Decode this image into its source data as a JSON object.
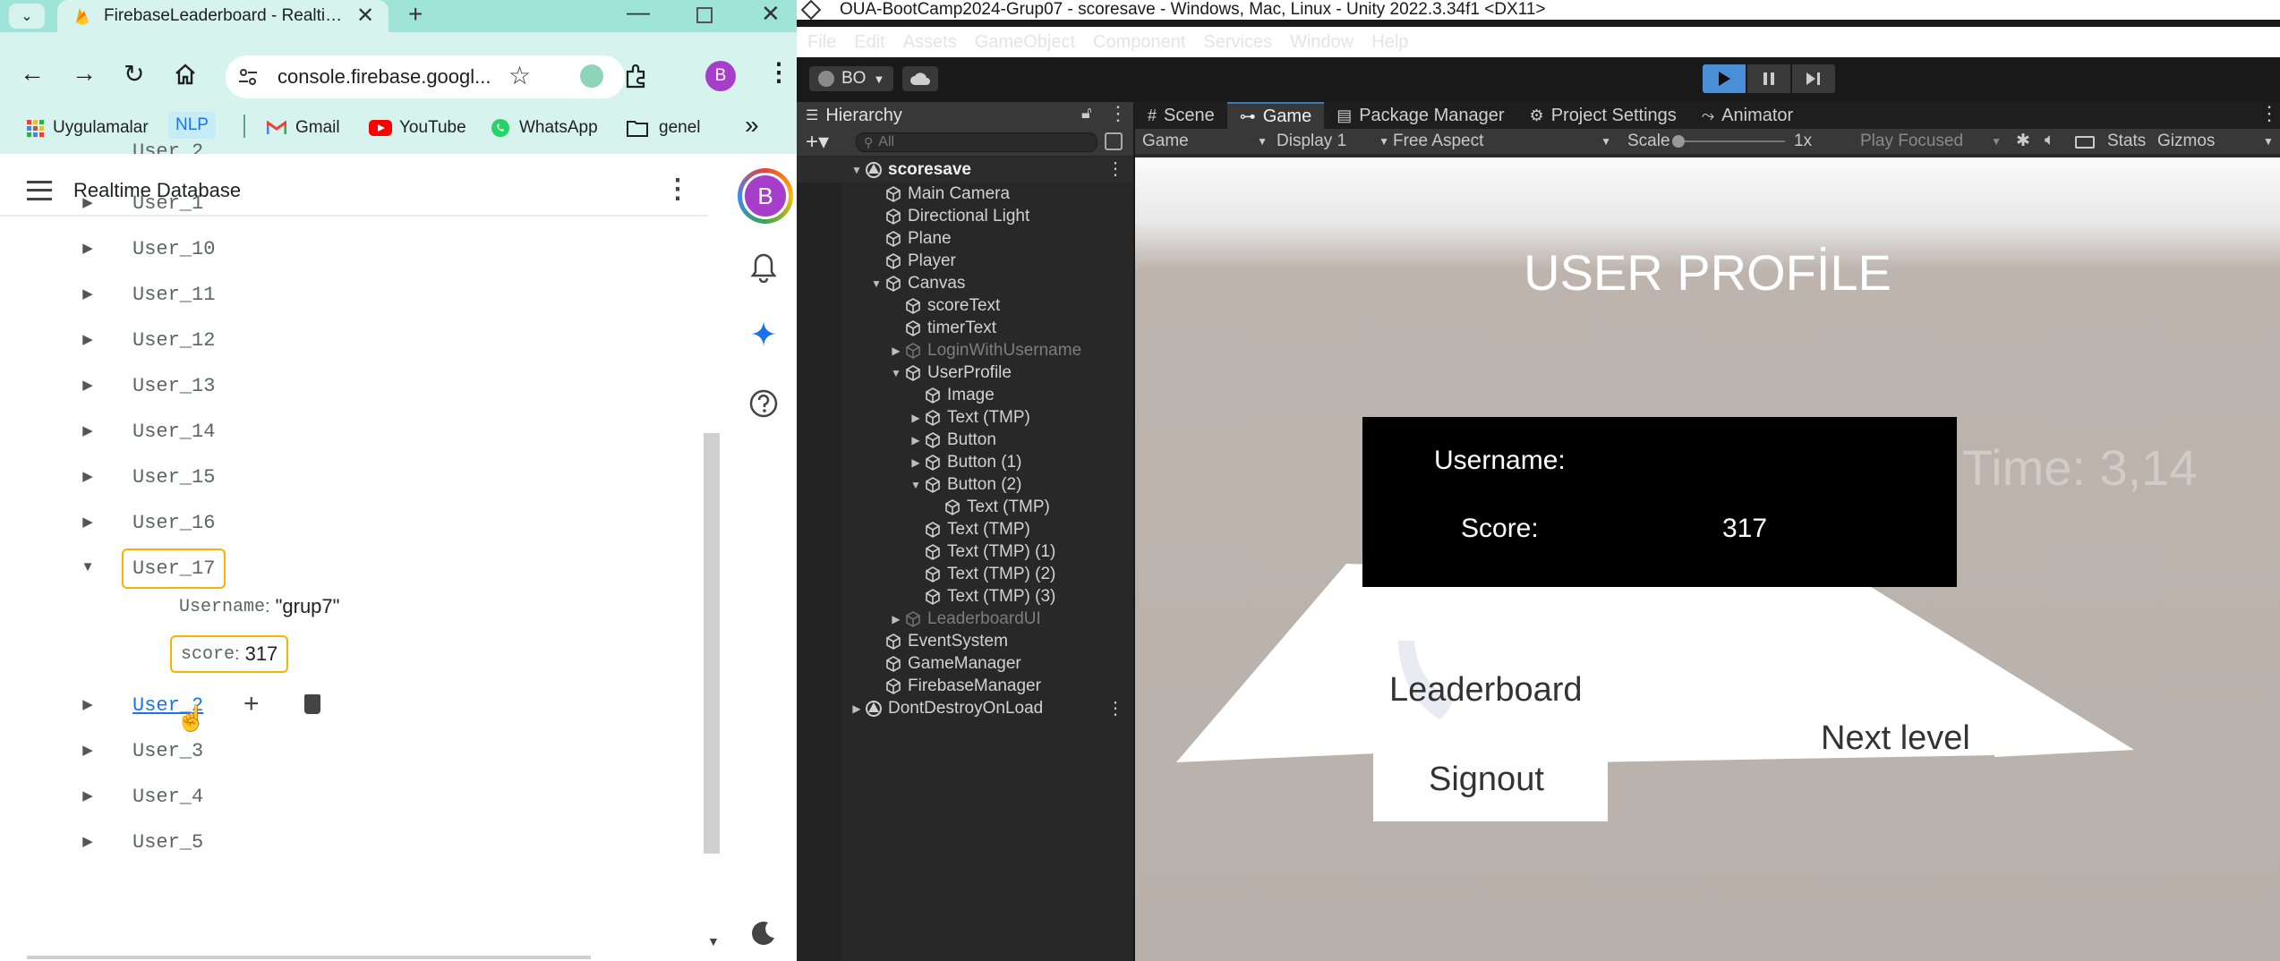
{
  "browser": {
    "tab_title": "FirebaseLeaderboard - Realtime Database",
    "new_tab": "+",
    "url": "console.firebase.googl...",
    "profile_letter": "B",
    "bookmarks": [
      {
        "label": "Uygulamalar",
        "icon": "apps-grid-icon"
      },
      {
        "label": "NLP",
        "icon": ""
      },
      {
        "label": "Gmail",
        "icon": "gmail-icon"
      },
      {
        "label": "YouTube",
        "icon": "youtube-icon"
      },
      {
        "label": "WhatsApp",
        "icon": "whatsapp-icon"
      },
      {
        "label": "genel",
        "icon": "folder-icon"
      }
    ],
    "more_bookmarks": "»"
  },
  "firebase": {
    "header_title": "Realtime Database",
    "avatar_letter": "B",
    "nodes": [
      "User_1",
      "User_10",
      "User_11",
      "User_12",
      "User_13",
      "User_14",
      "User_15",
      "User_16",
      "User_17"
    ],
    "expanded_node": "User_17",
    "children": [
      {
        "key": "Username",
        "value": "\"grup7\""
      },
      {
        "key": "score",
        "value": "317"
      }
    ],
    "hover_node": "User_2",
    "nodes_after": [
      "User_3",
      "User_4",
      "User_5"
    ]
  },
  "unity": {
    "window_title": "OUA-BootCamp2024-Grup07 - scoresave - Windows, Mac, Linux - Unity 2022.3.34f1 <DX11>",
    "menu": [
      "File",
      "Edit",
      "Assets",
      "GameObject",
      "Component",
      "Services",
      "Window",
      "Help"
    ],
    "account": "BO",
    "hierarchy": {
      "tab": "Hierarchy",
      "search_placeholder": "All",
      "items": [
        {
          "label": "scoresave",
          "depth": 0,
          "fold": "open",
          "kind": "scene",
          "dim": false
        },
        {
          "label": "Main Camera",
          "depth": 1,
          "fold": "",
          "kind": "go",
          "dim": false
        },
        {
          "label": "Directional Light",
          "depth": 1,
          "fold": "",
          "kind": "go",
          "dim": false
        },
        {
          "label": "Plane",
          "depth": 1,
          "fold": "",
          "kind": "go",
          "dim": false
        },
        {
          "label": "Player",
          "depth": 1,
          "fold": "",
          "kind": "go",
          "dim": false
        },
        {
          "label": "Canvas",
          "depth": 1,
          "fold": "open",
          "kind": "go",
          "dim": false
        },
        {
          "label": "scoreText",
          "depth": 2,
          "fold": "",
          "kind": "go",
          "dim": false
        },
        {
          "label": "timerText",
          "depth": 2,
          "fold": "",
          "kind": "go",
          "dim": false
        },
        {
          "label": "LoginWithUsername",
          "depth": 2,
          "fold": "closed",
          "kind": "go",
          "dim": true
        },
        {
          "label": "UserProfile",
          "depth": 2,
          "fold": "open",
          "kind": "go",
          "dim": false
        },
        {
          "label": "Image",
          "depth": 3,
          "fold": "",
          "kind": "go",
          "dim": false
        },
        {
          "label": "Text (TMP)",
          "depth": 3,
          "fold": "closed",
          "kind": "go",
          "dim": false
        },
        {
          "label": "Button",
          "depth": 3,
          "fold": "closed",
          "kind": "go",
          "dim": false
        },
        {
          "label": "Button (1)",
          "depth": 3,
          "fold": "closed",
          "kind": "go",
          "dim": false
        },
        {
          "label": "Button (2)",
          "depth": 3,
          "fold": "open",
          "kind": "go",
          "dim": false
        },
        {
          "label": "Text (TMP)",
          "depth": 4,
          "fold": "",
          "kind": "go",
          "dim": false
        },
        {
          "label": "Text (TMP)",
          "depth": 3,
          "fold": "",
          "kind": "go",
          "dim": false
        },
        {
          "label": "Text (TMP) (1)",
          "depth": 3,
          "fold": "",
          "kind": "go",
          "dim": false
        },
        {
          "label": "Text (TMP) (2)",
          "depth": 3,
          "fold": "",
          "kind": "go",
          "dim": false
        },
        {
          "label": "Text (TMP) (3)",
          "depth": 3,
          "fold": "",
          "kind": "go",
          "dim": false
        },
        {
          "label": "LeaderboardUI",
          "depth": 2,
          "fold": "closed",
          "kind": "go",
          "dim": true
        },
        {
          "label": "EventSystem",
          "depth": 1,
          "fold": "",
          "kind": "go",
          "dim": false
        },
        {
          "label": "GameManager",
          "depth": 1,
          "fold": "",
          "kind": "go",
          "dim": false
        },
        {
          "label": "FirebaseManager",
          "depth": 1,
          "fold": "",
          "kind": "go",
          "dim": false
        },
        {
          "label": "DontDestroyOnLoad",
          "depth": 0,
          "fold": "closed",
          "kind": "scene",
          "dim": false
        }
      ]
    },
    "tabs": [
      "Scene",
      "Game",
      "Package Manager",
      "Project Settings",
      "Animator"
    ],
    "active_tab": "Game",
    "game_toolbar": {
      "mode": "Game",
      "display": "Display 1",
      "aspect": "Free Aspect",
      "scale_label": "Scale",
      "scale_value": "1x",
      "play_mode": "Play Focused",
      "stats": "Stats",
      "gizmos": "Gizmos"
    },
    "game": {
      "title": "USER PROFİLE",
      "username_label": "Username:",
      "score_label": "Score:",
      "score_value": "317",
      "time_text": "Time: 3,14",
      "leaderboard": "Leaderboard",
      "signout": "Signout",
      "next_level": "Next level"
    }
  }
}
